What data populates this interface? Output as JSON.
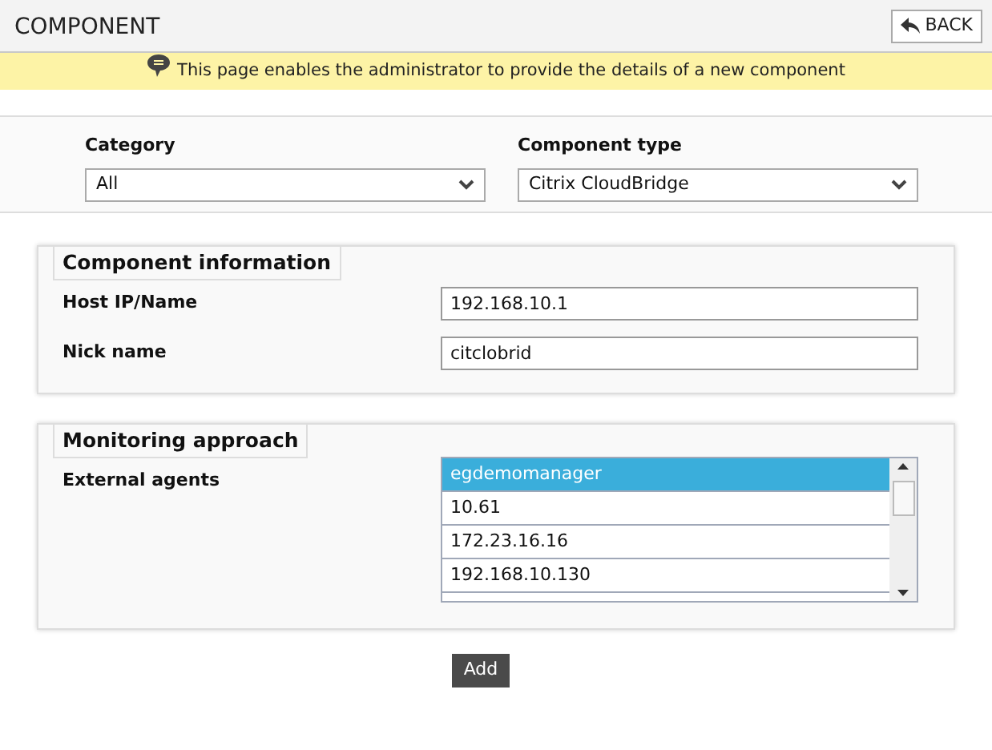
{
  "header": {
    "title": "COMPONENT",
    "back_button": "BACK"
  },
  "banner": {
    "text": "This page enables the administrator to provide the details of a new component"
  },
  "selectors": [
    {
      "label": "Category",
      "value": "All"
    },
    {
      "label": "Component type",
      "value": "Citrix CloudBridge"
    }
  ],
  "component_information": {
    "title": "Component information",
    "fields": [
      {
        "label": "Host IP/Name",
        "value": "192.168.10.1"
      },
      {
        "label": "Nick name",
        "value": "citclobrid"
      }
    ]
  },
  "monitoring_approach": {
    "title": "Monitoring approach",
    "label": "External agents",
    "agents": [
      {
        "name": "egdemomanager",
        "selected": true
      },
      {
        "name": "10.61",
        "selected": false
      },
      {
        "name": "172.23.16.16",
        "selected": false
      },
      {
        "name": "192.168.10.130",
        "selected": false
      }
    ]
  },
  "add_button": "Add"
}
